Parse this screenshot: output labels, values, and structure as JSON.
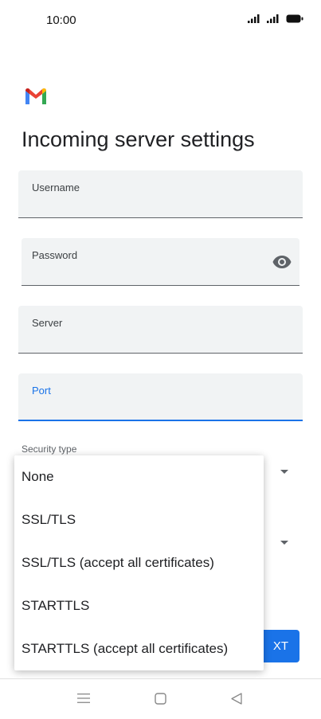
{
  "status_bar": {
    "time": "10:00"
  },
  "app": {
    "icon": "gmail-logo"
  },
  "page": {
    "title": "Incoming server settings"
  },
  "form": {
    "username_label": "Username",
    "password_label": "Password",
    "server_label": "Server",
    "port_label": "Port",
    "security_type_label": "Security type"
  },
  "security_menu": {
    "options": [
      "None",
      "SSL/TLS",
      "SSL/TLS (accept all certificates)",
      "STARTTLS",
      "STARTTLS (accept all certificates)"
    ]
  },
  "actions": {
    "next_label_visible": "XT"
  },
  "colors": {
    "accent": "#1a73e8",
    "field_bg": "#f1f3f4"
  }
}
